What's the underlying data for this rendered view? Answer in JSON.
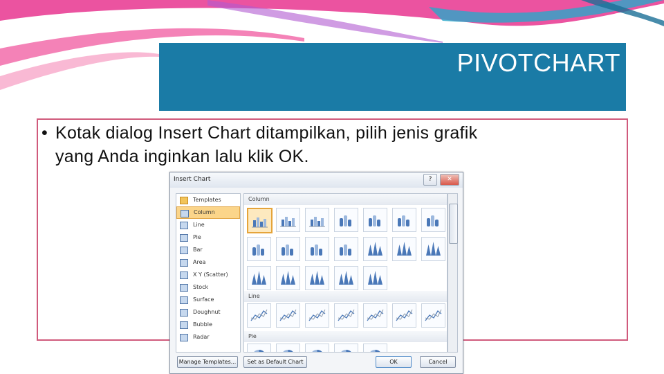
{
  "slide": {
    "title": "PIVOTCHART",
    "bullet_line1": "Kotak dialog Insert Chart ditampilkan, pilih jenis grafik",
    "bullet_line2": "yang Anda inginkan lalu klik OK.",
    "colors": {
      "title_bar": "#1a7ba6",
      "content_border": "#d05a7c"
    }
  },
  "dialog": {
    "title": "Insert Chart",
    "help_label": "?",
    "close_label": "✕",
    "sidebar": [
      {
        "label": "Templates",
        "icon": "folder-icon"
      },
      {
        "label": "Column",
        "icon": "column-chart-icon",
        "selected": true
      },
      {
        "label": "Line",
        "icon": "line-chart-icon"
      },
      {
        "label": "Pie",
        "icon": "pie-chart-icon"
      },
      {
        "label": "Bar",
        "icon": "bar-chart-icon"
      },
      {
        "label": "Area",
        "icon": "area-chart-icon"
      },
      {
        "label": "X Y (Scatter)",
        "icon": "scatter-chart-icon"
      },
      {
        "label": "Stock",
        "icon": "stock-chart-icon"
      },
      {
        "label": "Surface",
        "icon": "surface-chart-icon"
      },
      {
        "label": "Doughnut",
        "icon": "doughnut-chart-icon"
      },
      {
        "label": "Bubble",
        "icon": "bubble-chart-icon"
      },
      {
        "label": "Radar",
        "icon": "radar-chart-icon"
      }
    ],
    "sections": {
      "column": "Column",
      "line": "Line",
      "pie": "Pie"
    },
    "buttons": {
      "manage_templates": "Manage Templates...",
      "set_default": "Set as Default Chart",
      "ok": "OK",
      "cancel": "Cancel"
    }
  }
}
